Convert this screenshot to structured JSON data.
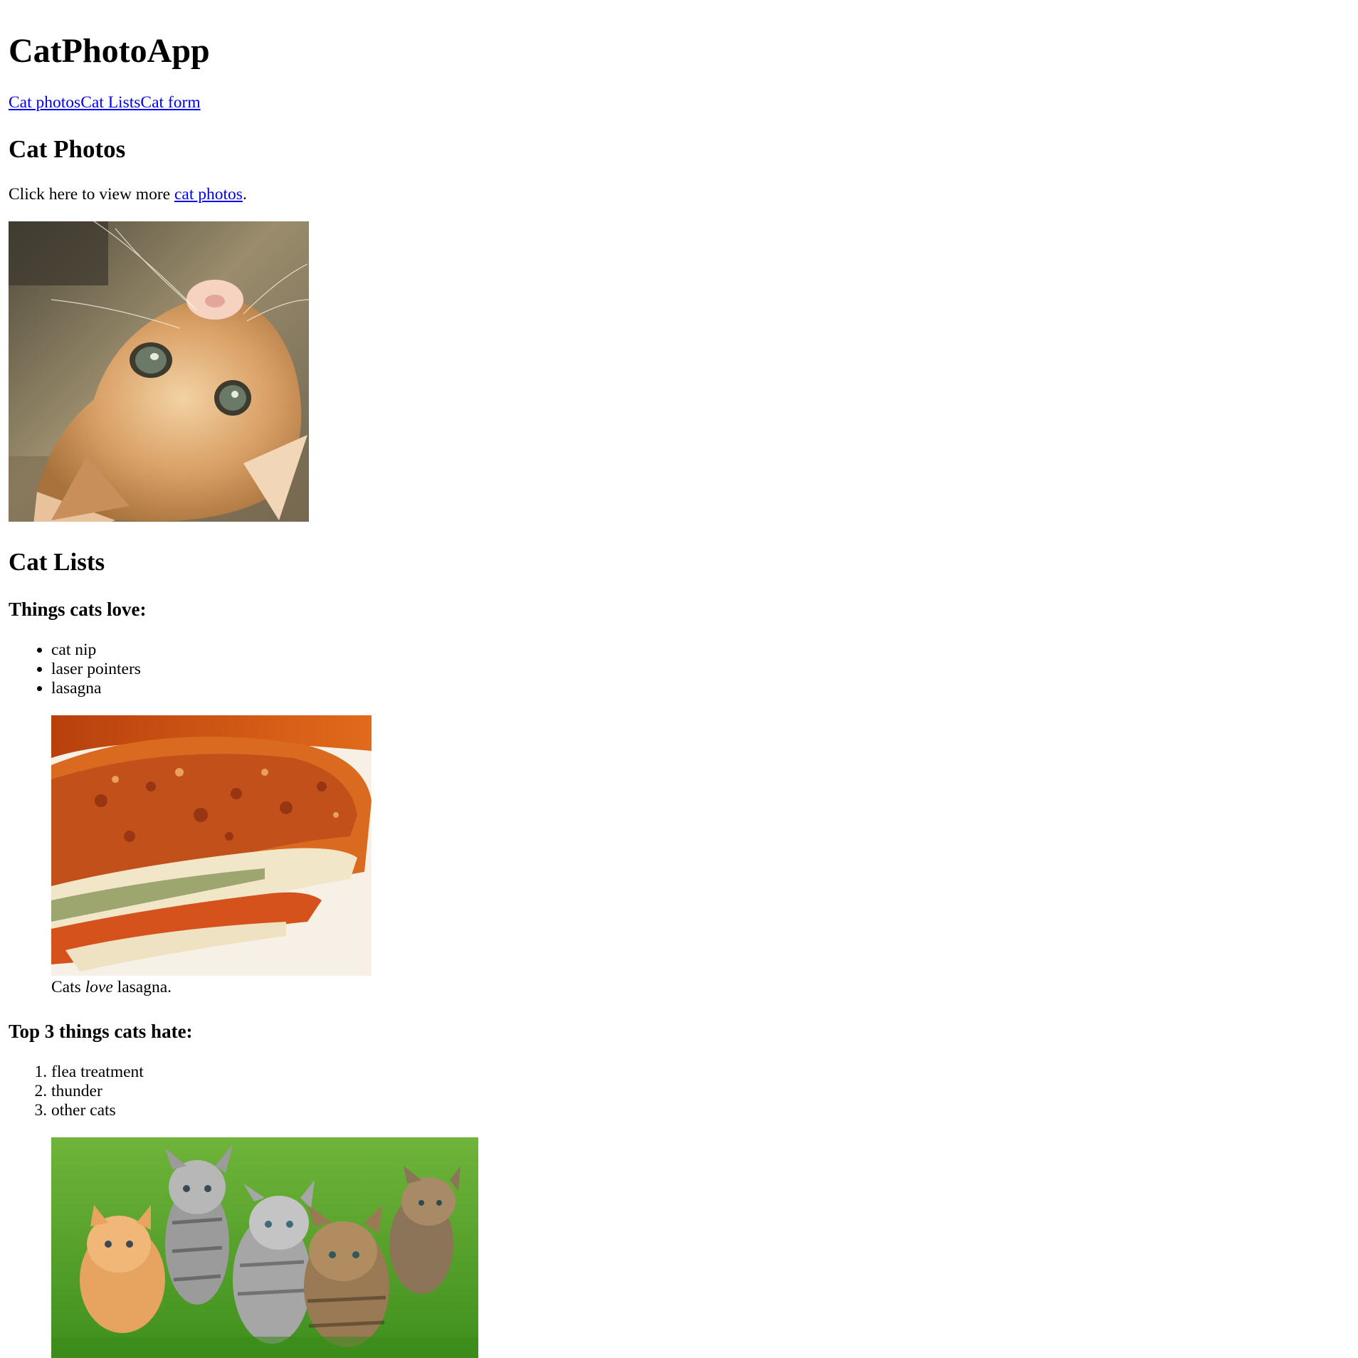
{
  "header": {
    "title": "CatPhotoApp",
    "nav": [
      {
        "label": "Cat photos"
      },
      {
        "label": "Cat Lists"
      },
      {
        "label": "Cat form"
      }
    ]
  },
  "cat_photos_section": {
    "heading": "Cat Photos",
    "intro_prefix": "Click here to view more ",
    "intro_link": "cat photos",
    "intro_suffix": ".",
    "image_alt": "A cute orange cat lying on its back."
  },
  "cat_lists_section": {
    "heading": "Cat Lists",
    "love_heading": "Things cats love:",
    "love_items": [
      "cat nip",
      "laser pointers",
      "lasagna"
    ],
    "lasagna_image_alt": "A slice of lasagna on a plate.",
    "caption_prefix": "Cats ",
    "caption_emphasis": "love",
    "caption_suffix": " lasagna.",
    "hate_heading": "Top 3 things cats hate:",
    "hate_items": [
      "flea treatment",
      "thunder",
      "other cats"
    ],
    "kittens_image_alt": "Five cats looking around a field."
  }
}
